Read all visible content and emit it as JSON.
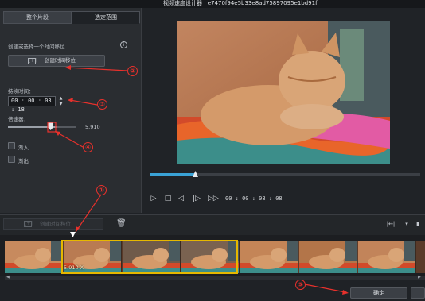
{
  "window": {
    "title": "视频速度设计器  |  e7470f94e5b33e8ad75897095e1bd91f"
  },
  "tabs": [
    {
      "label": "整个片段"
    },
    {
      "label": "选定范围"
    }
  ],
  "panel": {
    "create_label": "创建或选择一个时间移位",
    "create_button": "创建时间移位",
    "create_button_icon": "[+]",
    "duration_label": "持续时间：",
    "duration_value": "00 : 00 : 03 : 18",
    "speed_label": "倍速器：",
    "speed_value": "5.910",
    "speed_fraction": 0.72,
    "fade_in": "渐入",
    "fade_out": "渐出"
  },
  "player": {
    "timecode": "00 : 00 : 08 : 08",
    "progress_fraction": 0.17
  },
  "timeline": {
    "create_button": "创建时间移位",
    "create_button_icon": "[+]",
    "selection_label": "5.910 X",
    "frame_count": 7
  },
  "footer": {
    "ok_button": "确定"
  },
  "annotations": [
    {
      "label": "①"
    },
    {
      "label": "②"
    },
    {
      "label": "③"
    },
    {
      "label": "④"
    },
    {
      "label": "⑤"
    }
  ],
  "colors": {
    "annotation": "#e8312c",
    "selection": "#e6b800",
    "progress": "#3aa2d6"
  }
}
